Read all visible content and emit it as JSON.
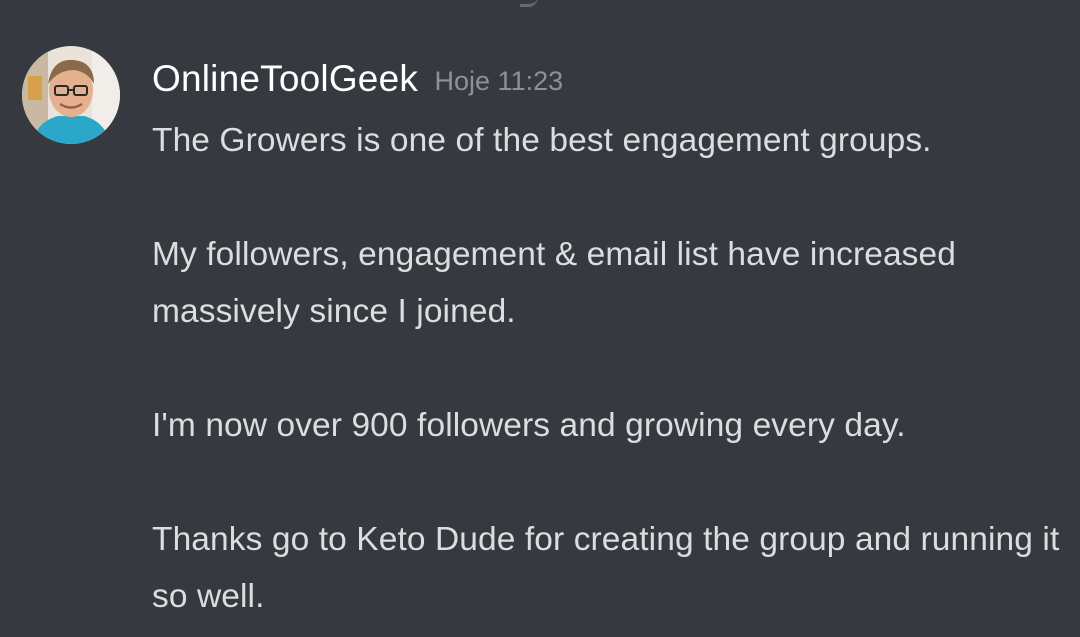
{
  "message": {
    "username": "OnlineToolGeek",
    "timestamp": "Hoje 11:23",
    "avatar_icon": "user-avatar",
    "paragraphs": [
      "The Growers is one of the best engagement groups.",
      "My followers, engagement & email list have increased massively since I joined.",
      "I'm now over 900 followers and growing every day.",
      "Thanks go to Keto Dude for creating the group and running it so well."
    ]
  },
  "colors": {
    "background": "#36393f",
    "username": "#ffffff",
    "timestamp": "#8e9297",
    "text": "#dcddde"
  }
}
